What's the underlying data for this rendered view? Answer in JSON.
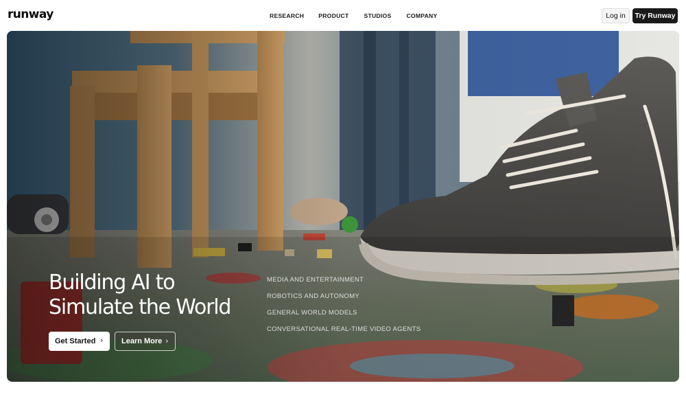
{
  "header": {
    "logo": "runway",
    "nav": [
      "RESEARCH",
      "PRODUCT",
      "STUDIOS",
      "COMPANY"
    ],
    "login_label": "Log in",
    "try_label": "Try Runway"
  },
  "hero": {
    "headline_line1": "Building AI to",
    "headline_line2": "Simulate the World",
    "get_started_label": "Get Started",
    "learn_more_label": "Learn More",
    "chevron": "›",
    "sectors": [
      "MEDIA AND ENTERTAINMENT",
      "ROBOTICS AND AUTONOMY",
      "GENERAL WORLD MODELS",
      "CONVERSATIONAL REAL-TIME VIDEO AGENTS"
    ]
  },
  "colors": {
    "accent": "#1a1a1a",
    "background": "#ffffff"
  }
}
